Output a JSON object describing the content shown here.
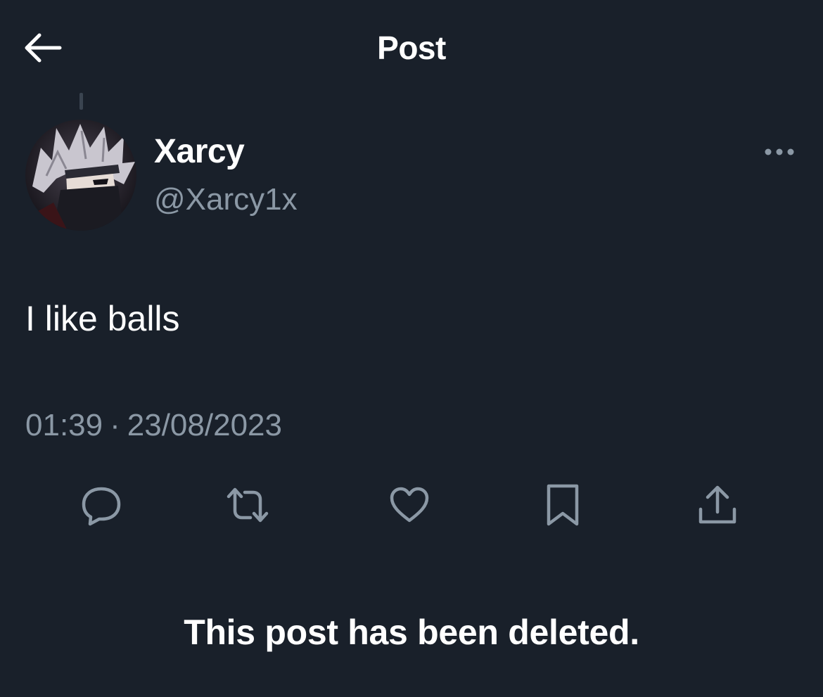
{
  "header": {
    "title": "Post",
    "back_icon": "arrow-left-icon"
  },
  "author": {
    "display_name": "Xarcy",
    "handle": "@Xarcy1x"
  },
  "post": {
    "text": "I like balls",
    "time": "01:39",
    "separator": "·",
    "date": "23/08/2023"
  },
  "actions": [
    {
      "name": "reply",
      "icon": "speech-bubble-icon"
    },
    {
      "name": "repost",
      "icon": "repost-arrows-icon"
    },
    {
      "name": "like",
      "icon": "heart-icon"
    },
    {
      "name": "bookmark",
      "icon": "bookmark-icon"
    },
    {
      "name": "share",
      "icon": "share-upload-icon"
    }
  ],
  "notice": "This post has been deleted.",
  "colors": {
    "background": "#19202a",
    "text_primary": "#ffffff",
    "text_secondary": "#8b98a5",
    "icon_gray": "#8b98a5"
  }
}
